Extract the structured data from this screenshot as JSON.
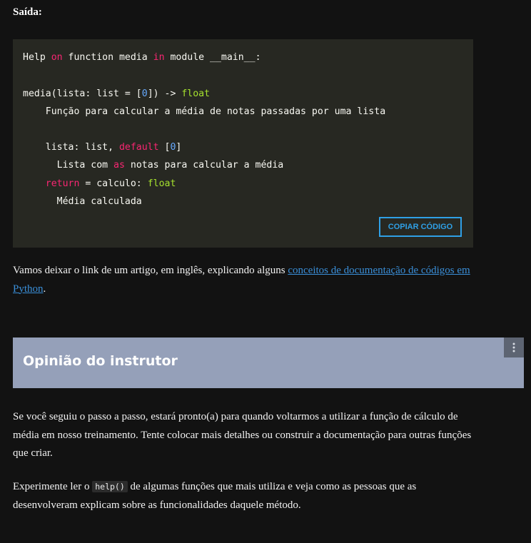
{
  "output_label": "Saída:",
  "code": {
    "l1_a": "Help ",
    "l1_b": "on",
    "l1_c": " function media ",
    "l1_d": "in",
    "l1_e": " module __main__:",
    "l2_a": "media(lista: list = [",
    "l2_b": "0",
    "l2_c": "]) -> ",
    "l2_d": "float",
    "l3": "    Função para calcular a média de notas passadas por uma lista",
    "l4_a": "    lista: list, ",
    "l4_b": "default",
    "l4_c": " [",
    "l4_d": "0",
    "l4_e": "]",
    "l5_a": "      Lista com ",
    "l5_b": "as",
    "l5_c": " notas para calcular a média",
    "l6_a": "    ",
    "l6_b": "return",
    "l6_c": " = calculo: ",
    "l6_d": "float",
    "l7": "      Média calculada",
    "copy_label": "COPIAR CÓDIGO"
  },
  "para1": {
    "before": "Vamos deixar o link de um artigo, em inglês, explicando alguns ",
    "link": "conceitos de documentação de códigos em Python",
    "after": "."
  },
  "section": {
    "title": "Opinião do instrutor",
    "menu_icon": "more-vertical-icon"
  },
  "para2": "Se você seguiu o passo a passo, estará pronto(a) para quando voltarmos a utilizar a função de cálculo de média em nosso treinamento. Tente colocar mais detalhes ou construir a documentação para outras funções que criar.",
  "para3": {
    "before": "Experimente ler o ",
    "code": "help()",
    "after": " de algumas funções que mais utiliza e veja como as pessoas que as desenvolveram explicam sobre as funcionalidades daquele método."
  },
  "colors": {
    "background": "#121212",
    "code_bg": "#272822",
    "keyword": "#f92672",
    "type": "#a6e22e",
    "number": "#66aaff",
    "accent": "#2fa0e6",
    "banner": "#95a0b9"
  }
}
